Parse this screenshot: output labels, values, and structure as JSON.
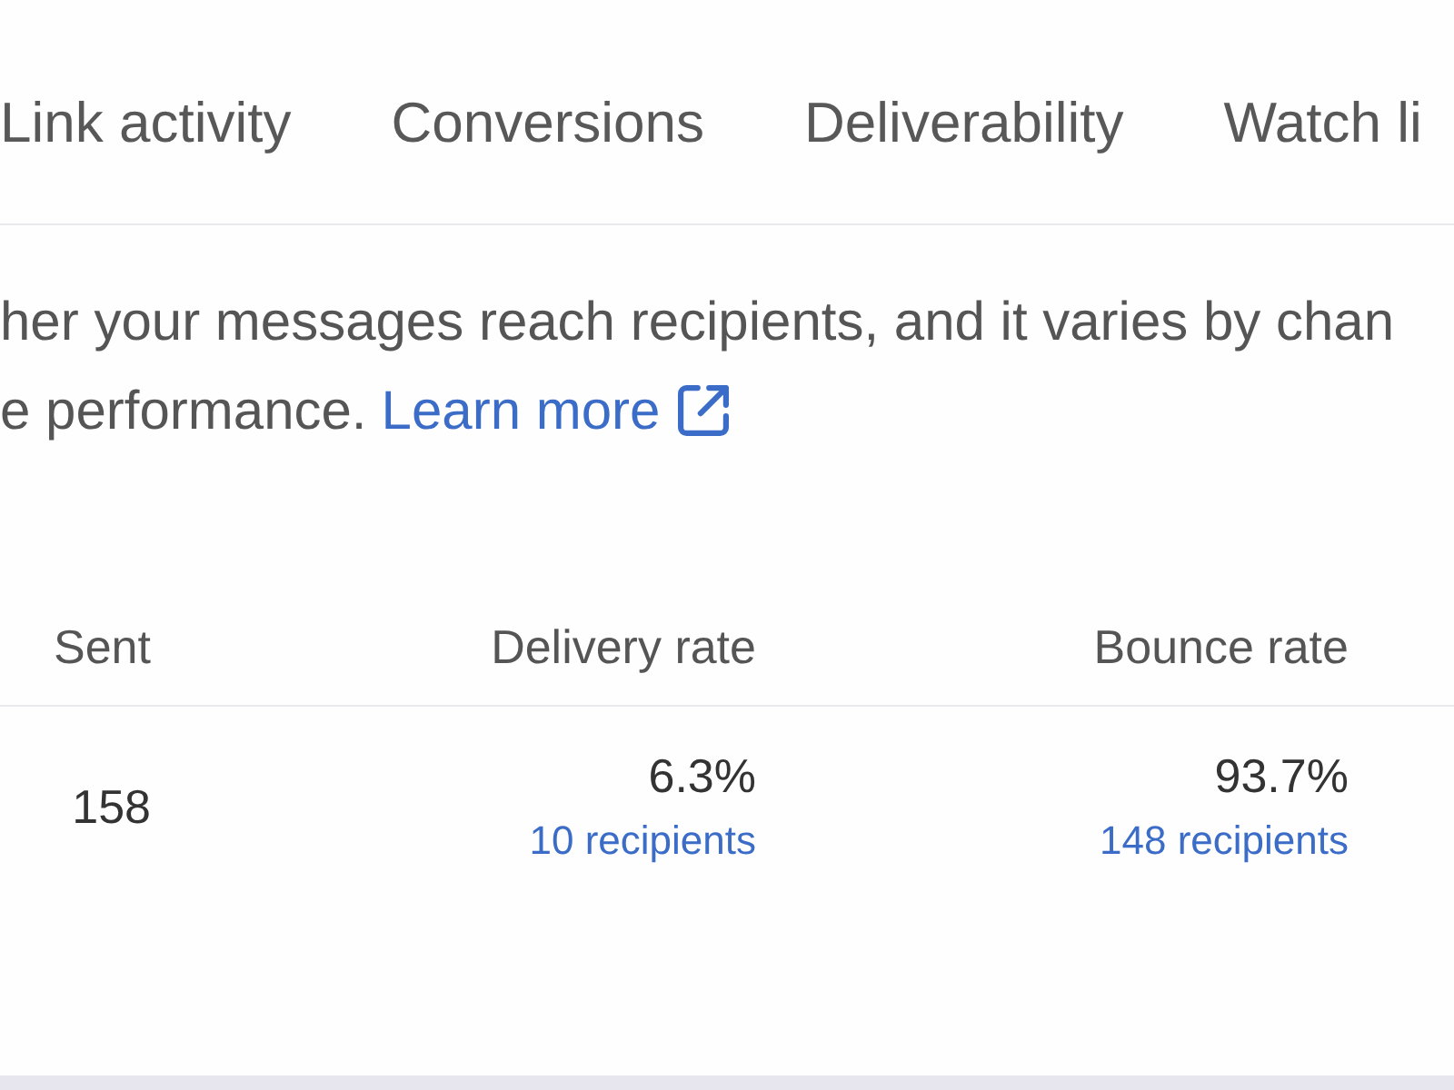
{
  "tabs": [
    {
      "label": "Link activity"
    },
    {
      "label": "Conversions"
    },
    {
      "label": "Deliverability"
    },
    {
      "label": "Watch li"
    }
  ],
  "description": {
    "lines": [
      "her your messages reach recipients, and it varies by chan",
      "e performance."
    ],
    "link": "Learn more"
  },
  "table": {
    "columns": [
      "Sent",
      "Delivery rate",
      "Bounce rate"
    ],
    "rows": [
      {
        "cells": [
          {
            "value": "158"
          },
          {
            "value": "6.3%",
            "link": "10 recipients"
          },
          {
            "value": "93.7%",
            "link": "148 recipients"
          }
        ]
      }
    ]
  }
}
